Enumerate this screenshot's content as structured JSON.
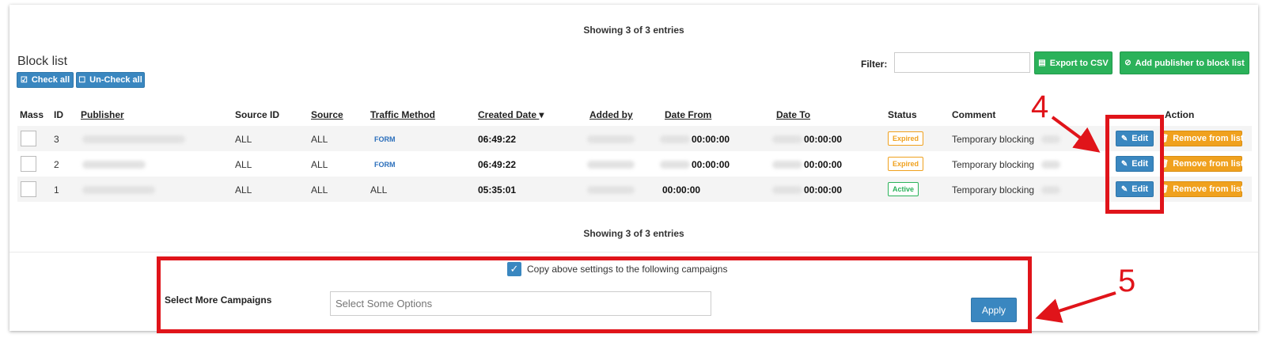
{
  "showing_top": "Showing 3 of 3 entries",
  "showing_bottom": "Showing 3 of 3 entries",
  "title": "Block list",
  "check_all": "Check all",
  "uncheck_all": "Un-Check all",
  "filter_label": "Filter:",
  "filter_value": "",
  "export_csv": "Export to CSV",
  "add_publisher": "Add publisher to block list",
  "columns": {
    "mass": "Mass",
    "id": "ID",
    "publisher": "Publisher",
    "source_id": "Source ID",
    "source": "Source",
    "traffic_method": "Traffic Method",
    "created_date": "Created Date",
    "sort_arrow": "▾",
    "added_by": "Added by",
    "date_from": "Date From",
    "date_to": "Date To",
    "status": "Status",
    "comment": "Comment",
    "action": "Action"
  },
  "rows": [
    {
      "id": "3",
      "source_id": "ALL",
      "source": "ALL",
      "traffic_method": "FORM",
      "created_time": "06:49:22",
      "date_from": "00:00:00",
      "date_to": "00:00:00",
      "status": "Expired",
      "comment": "Temporary blocking",
      "edit": "Edit",
      "remove": "Remove from list"
    },
    {
      "id": "2",
      "source_id": "ALL",
      "source": "ALL",
      "traffic_method": "FORM",
      "created_time": "06:49:22",
      "date_from": "00:00:00",
      "date_to": "00:00:00",
      "status": "Expired",
      "comment": "Temporary blocking",
      "edit": "Edit",
      "remove": "Remove from list"
    },
    {
      "id": "1",
      "source_id": "ALL",
      "source": "ALL",
      "traffic_method": "ALL",
      "created_time": "05:35:01",
      "date_from": "00:00:00",
      "date_to": "00:00:00",
      "status": "Active",
      "comment": "Temporary blocking",
      "edit": "Edit",
      "remove": "Remove from list"
    }
  ],
  "copy_settings_label": "Copy above settings to the following campaigns",
  "copy_settings_checked": true,
  "select_more_label": "Select More Campaigns",
  "select_placeholder": "Select Some Options",
  "apply": "Apply",
  "callout_4": "4",
  "callout_5": "5",
  "colors": {
    "blue": "#3a87c0",
    "green": "#2bb25a",
    "orange": "#f0a11e",
    "red_annotation": "#e0141a"
  },
  "icons": {
    "check_all": "check-square-icon",
    "uncheck_all": "square-icon",
    "export": "file-excel-icon",
    "add": "ban-icon",
    "edit": "edit-icon",
    "remove": "trash-icon"
  }
}
